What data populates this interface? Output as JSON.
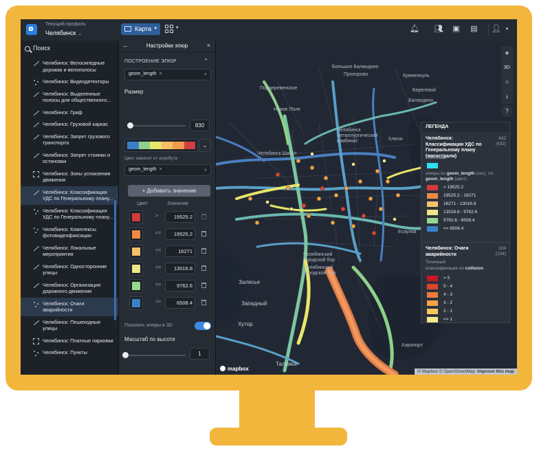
{
  "app": {
    "profile_caption": "Текущий профиль",
    "profile_name": "Челябинск",
    "map_button_label": "Карта"
  },
  "colors": {
    "frame": "#f3b63c",
    "accent": "#3f8ae0",
    "panel_bg": "#262c34",
    "map_bg": "#222833"
  },
  "toolbar_icons": [
    "bell-icon",
    "users-icon",
    "archive-icon",
    "clipboard-icon",
    "user-avatar-icon"
  ],
  "sidebar": {
    "search_label": "Поиск",
    "layers": [
      {
        "label": "Челябинск: Велосипедные дорожки и велополосы",
        "icon": "line-layer-icon"
      },
      {
        "label": "Челябинск: Видеодетекторы",
        "icon": "point-layer-icon"
      },
      {
        "label": "Челябинск: Выделенные полосы для общественного...",
        "icon": "line-layer-icon"
      },
      {
        "label": "Челябинск: Граф",
        "icon": "line-layer-icon"
      },
      {
        "label": "Челябинск: Грузовой каркас",
        "icon": "line-layer-icon"
      },
      {
        "label": "Челябинск: Запрет грузового транспорта",
        "icon": "line-layer-icon"
      },
      {
        "label": "Челябинск: Запрет стоянки и остановки",
        "icon": "line-layer-icon"
      },
      {
        "label": "Челябинск: Зоны успокоения движения",
        "icon": "polygon-layer-icon"
      },
      {
        "label": "Челябинск: Классификация УДС по Генеральному плану...",
        "icon": "line-layer-icon",
        "selected": true
      },
      {
        "label": "Челябинск: Классификация УДС по Генеральному плану...",
        "icon": "point-layer-icon"
      },
      {
        "label": "Челябинск: Комплексы фотовидеофиксации",
        "icon": "point-layer-icon"
      },
      {
        "label": "Челябинск: Локальные мероприятия",
        "icon": "line-layer-icon"
      },
      {
        "label": "Челябинск: Односторонние улицы",
        "icon": "line-layer-icon"
      },
      {
        "label": "Челябинск: Организация дорожного движения",
        "icon": "line-layer-icon"
      },
      {
        "label": "Челябинск: Очаги аварийности",
        "icon": "point-layer-icon",
        "selected": true
      },
      {
        "label": "Челябинск: Пешеходные улицы",
        "icon": "line-layer-icon"
      },
      {
        "label": "Челябинск: Платные парковки",
        "icon": "polygon-layer-icon"
      },
      {
        "label": "Челябинск: Пункты",
        "icon": "point-layer-icon"
      }
    ]
  },
  "panel": {
    "title": "Настройки эпюр",
    "section": "ПОСТРОЕНИЕ ЭПЮР",
    "attribute_chip": "geom_length",
    "size_label": "Размер",
    "size_value": "830",
    "size_fraction": 0.05,
    "ramp_colors": [
      "#3a7ec8",
      "#8fd08a",
      "#e7e66a",
      "#f2c062",
      "#f19a4d",
      "#d24040"
    ],
    "color_attr_label": "Цвет зависит от атрибута",
    "color_attr_chip": "geom_length",
    "add_value_label": "+ Добавить значение",
    "col_color": "Цвет",
    "col_value": "Значение",
    "values": [
      {
        "color": "#d13b3b",
        "op": ">",
        "value": "19525.2"
      },
      {
        "color": "#ef8a45",
        "op": "<=",
        "value": "19525.2"
      },
      {
        "color": "#f4c26a",
        "op": "<=",
        "value": "16271"
      },
      {
        "color": "#ece58a",
        "op": "<=",
        "value": "13016.8"
      },
      {
        "color": "#98d68c",
        "op": "<=",
        "value": "9762.6"
      },
      {
        "color": "#3a82c9",
        "op": "<=",
        "value": "6508.4"
      }
    ],
    "show3d_label": "Показать эпюры в 3D",
    "show3d_on": true,
    "height_scale_label": "Масштаб по высоте",
    "height_scale_value": "1",
    "height_scale_fraction": 0.0
  },
  "map": {
    "labels": [
      "Большое Баландино",
      "Прохорово",
      "Кременкуль",
      "Берегевой",
      "Поддеревенское",
      "Баландино",
      "Новое Поле",
      "Челябинск Шагол",
      "Челябинск металлургический комбинат",
      "Ключи",
      "Есаулка",
      "Челябинский городской бор",
      "Челябинский городской бор",
      "Залесье",
      "Западный",
      "Хутор",
      "Таловка",
      "Аэропорт"
    ],
    "controls": [
      "layers-icon",
      "3D",
      "compass-icon",
      "download-icon",
      "help-icon"
    ],
    "mapbox_logo": "mapbox",
    "attribution": "© Mapbox © OpenStreetMap",
    "improve": "Improve this map"
  },
  "legend": {
    "title": "ЛЕГЕНДА",
    "layer1": {
      "name": "Челябинск: Классификация УДС по Генеральному плану (магистрали)",
      "count1": "432",
      "count2": "(432)",
      "type": "Линейный",
      "type_color": "#2ee0f0",
      "sub_pre": "эпюры по",
      "sub_attr": "geom_length",
      "sub_mid": "(sec), по",
      "sub_attr2": "geom_length",
      "sub_post": "(цвет)",
      "items": [
        {
          "color": "#d13b3b",
          "label": "> 19525.2"
        },
        {
          "color": "#ef8a45",
          "label": "19525.2 - 16271"
        },
        {
          "color": "#f4c26a",
          "label": "16271 - 13016.8"
        },
        {
          "color": "#ece58a",
          "label": "13016.8 - 9762.6"
        },
        {
          "color": "#98d68c",
          "label": "9762.6 - 6508.4"
        },
        {
          "color": "#3a82c9",
          "label": "<= 6508.4"
        }
      ]
    },
    "layer2": {
      "name": "Челябинск: Очаги аварийности",
      "count1": "104",
      "count2": "(104)",
      "type": "Точечный",
      "sub_pre": "классификация по",
      "sub_attr": "collision",
      "items": [
        {
          "color": "#c8172b",
          "label": "> 5"
        },
        {
          "color": "#e0452e",
          "label": "5 - 4"
        },
        {
          "color": "#f07a3a",
          "label": "4 - 3"
        },
        {
          "color": "#f5a448",
          "label": "3 - 2"
        },
        {
          "color": "#f8c75e",
          "label": "2 - 1"
        },
        {
          "color": "#f8e98a",
          "label": "<= 1"
        }
      ]
    }
  }
}
